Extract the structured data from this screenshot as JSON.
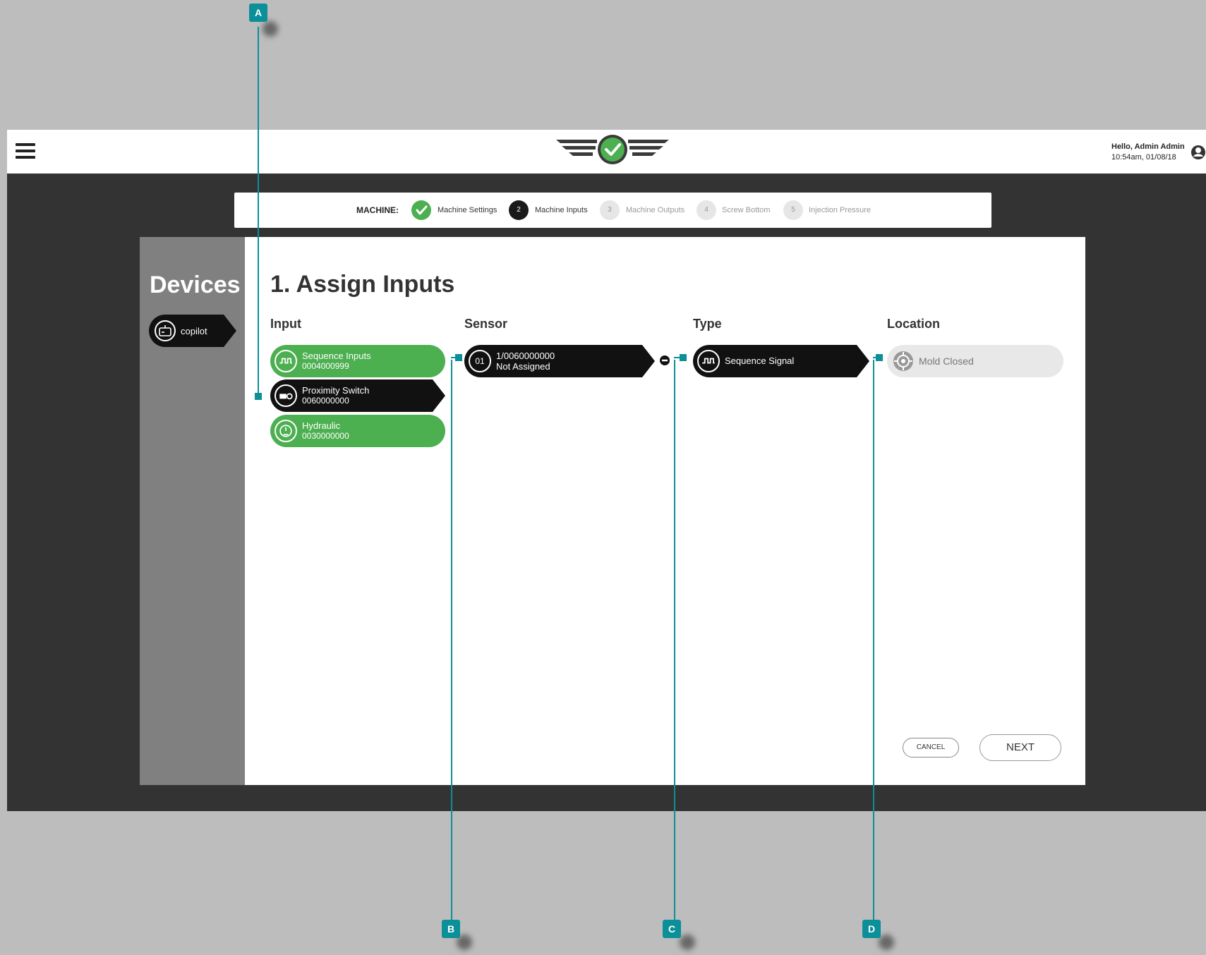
{
  "header": {
    "greeting": "Hello, Admin Admin",
    "datetime": "10:54am, 01/08/18",
    "icons": {
      "menu": "hamburger-menu-icon",
      "logo": "wings-check-logo",
      "account": "user-account-icon"
    }
  },
  "stepper": {
    "prefix": "MACHINE:",
    "steps": [
      {
        "number": "1",
        "label": "Machine Settings",
        "state": "complete"
      },
      {
        "number": "2",
        "label": "Machine Inputs",
        "state": "active"
      },
      {
        "number": "3",
        "label": "Machine Outputs",
        "state": "pending"
      },
      {
        "number": "4",
        "label": "Screw Bottom",
        "state": "pending"
      },
      {
        "number": "5",
        "label": "Injection Pressure",
        "state": "pending"
      }
    ]
  },
  "sidebar": {
    "title": "Devices",
    "device": {
      "label": "copilot",
      "icon": "device-icon"
    }
  },
  "main": {
    "title": "1. Assign Inputs",
    "columns": {
      "input": "Input",
      "sensor": "Sensor",
      "type": "Type",
      "location": "Location"
    },
    "inputs": [
      {
        "name": "Sequence Inputs",
        "id": "0004000999",
        "icon": "sequence-signal-icon",
        "state": "green"
      },
      {
        "name": "Proximity Switch",
        "id": "0060000000",
        "icon": "proximity-switch-icon",
        "state": "selected"
      },
      {
        "name": "Hydraulic",
        "id": "0030000000",
        "icon": "pressure-gauge-icon",
        "state": "green"
      }
    ],
    "sensor": {
      "number": "01",
      "id": "1/0060000000",
      "status": "Not Assigned"
    },
    "type": {
      "label": "Sequence Signal",
      "icon": "sequence-signal-icon"
    },
    "location": {
      "label": "Mold Closed",
      "icon": "target-icon"
    },
    "buttons": {
      "cancel": "CANCEL",
      "next": "NEXT"
    }
  },
  "callouts": [
    "A",
    "B",
    "C",
    "D"
  ],
  "colors": {
    "green": "#4caf50",
    "dark": "#111111",
    "teal": "#0b8f98",
    "panel_gray": "#808080"
  }
}
